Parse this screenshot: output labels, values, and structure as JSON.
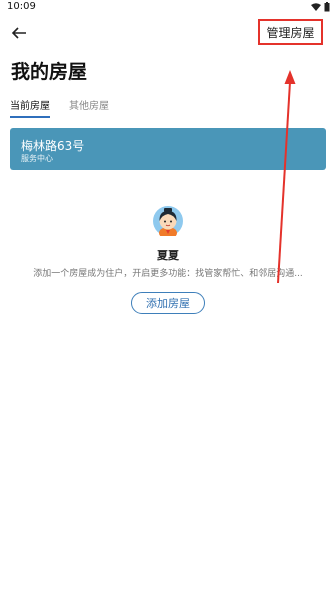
{
  "status_bar": {
    "time": "10:09"
  },
  "header": {
    "manage_label": "管理房屋"
  },
  "page": {
    "title": "我的房屋"
  },
  "tabs": [
    {
      "label": "当前房屋",
      "active": true
    },
    {
      "label": "其他房屋",
      "active": false
    }
  ],
  "card": {
    "title": "梅林路63号",
    "subtitle": "服务中心"
  },
  "assistant": {
    "name": "夏夏",
    "description": "添加一个房屋成为住户，开启更多功能：找管家帮忙、和邻居沟通...",
    "button": "添加房屋"
  },
  "colors": {
    "card": "#4a96b8",
    "accent": "#2f6fbc",
    "annotation": "#e4322b"
  }
}
